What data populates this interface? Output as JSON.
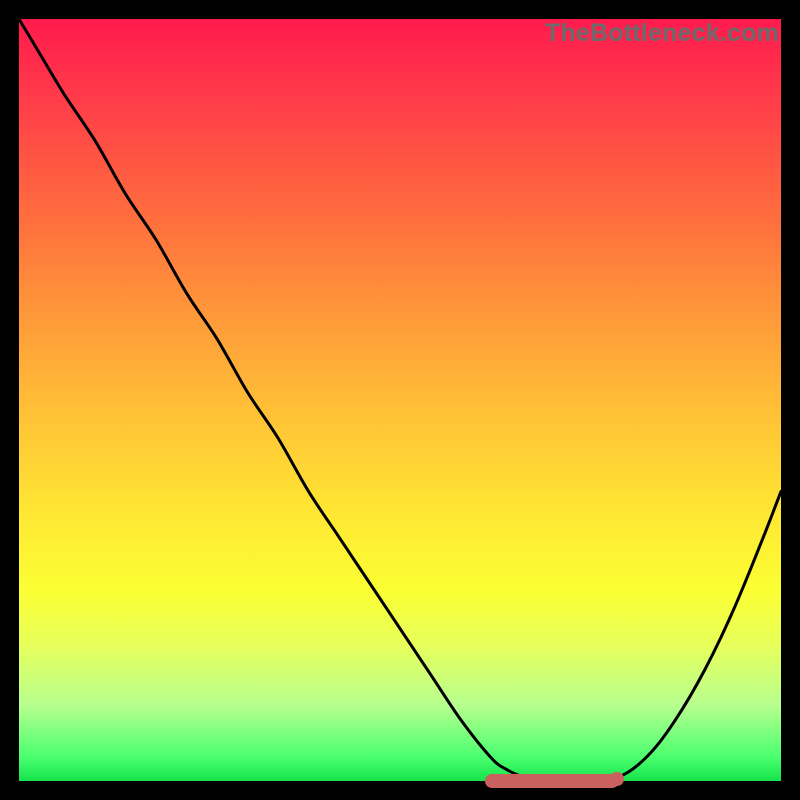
{
  "watermark": "TheBottleneck.com",
  "chart_data": {
    "type": "line",
    "title": "",
    "xlabel": "",
    "ylabel": "",
    "xlim": [
      0,
      100
    ],
    "ylim": [
      0,
      100
    ],
    "x": [
      0,
      3,
      6,
      10,
      14,
      18,
      22,
      26,
      30,
      34,
      38,
      42,
      46,
      50,
      54,
      58,
      62,
      64,
      66,
      68,
      70,
      72,
      74,
      76,
      78,
      80,
      82,
      84,
      86,
      88,
      90,
      92,
      94,
      96,
      98,
      100
    ],
    "y": [
      100,
      95,
      90,
      84,
      77,
      71,
      64,
      58,
      51,
      45,
      38,
      32,
      26,
      20,
      14,
      8,
      3,
      1.5,
      0.6,
      0.2,
      0,
      0,
      0,
      0,
      0.3,
      1.2,
      2.8,
      5,
      7.8,
      11,
      14.6,
      18.6,
      23,
      27.8,
      32.8,
      38
    ],
    "valley_segment": {
      "x_start": 62,
      "x_end": 78,
      "y": 0
    },
    "valley_end_point": {
      "x": 78.5,
      "y": 0.3
    },
    "gradient_stops": [
      {
        "pos": 0,
        "color": "#ff1a4d"
      },
      {
        "pos": 25,
        "color": "#ff6a3e"
      },
      {
        "pos": 52,
        "color": "#ffc236"
      },
      {
        "pos": 75,
        "color": "#fbff33"
      },
      {
        "pos": 100,
        "color": "#14e24b"
      }
    ]
  }
}
